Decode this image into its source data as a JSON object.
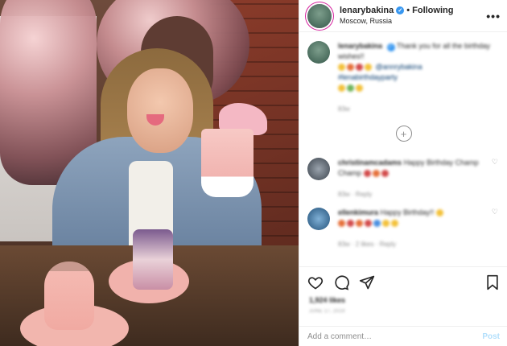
{
  "header": {
    "username": "lenarybakina",
    "separator": "•",
    "follow_label": "Following",
    "location": "Moscow, Russia",
    "more_label": "•••"
  },
  "caption": {
    "username": "lenarybakina",
    "text": "Thank you for all the birthday wishes!!",
    "mention": "@annrybakina",
    "hashtag": "#lenabirthdayparty",
    "time": "83w"
  },
  "load_more": {
    "label": "+"
  },
  "comments": [
    {
      "username": "christinamcadams",
      "text": "Happy Birthday Champ Champ",
      "meta": "83w · Reply"
    },
    {
      "username": "ellenkimura",
      "text": "Happy Birthday!!",
      "meta": "83w · 2 likes · Reply"
    }
  ],
  "likes": "1,924 likes",
  "date": "JUNE 17, 2019",
  "comment_box": {
    "placeholder": "Add a comment…",
    "post_label": "Post"
  },
  "colors": {
    "verified": "#3897f0",
    "post_disabled": "#b2dffc",
    "story_ring": "#d6249f"
  },
  "icons": [
    "heart-icon",
    "comment-icon",
    "share-icon",
    "bookmark-icon",
    "plus-circle-icon",
    "verified-icon"
  ]
}
